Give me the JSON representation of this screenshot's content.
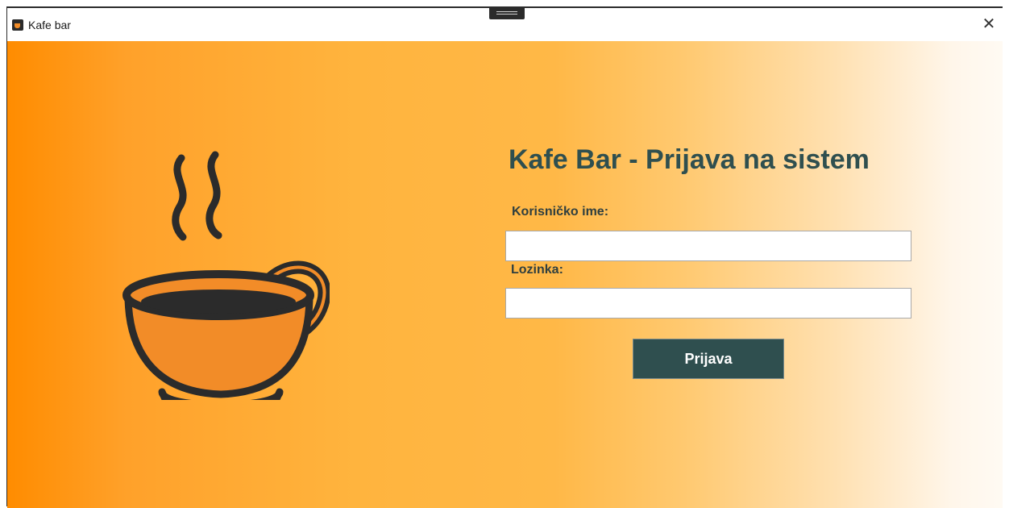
{
  "window": {
    "title": "Kafe bar",
    "app_icon": "coffee-cup-icon",
    "close_glyph": "✕"
  },
  "login": {
    "heading": "Kafe Bar - Prijava na sistem",
    "username_label": "Korisničko ime:",
    "username_value": "",
    "password_label": "Lozinka:",
    "password_value": "",
    "submit_label": "Prijava"
  },
  "illustration": {
    "icon": "coffee-cup-icon"
  },
  "colors": {
    "gradient_start": "#ff8c00",
    "gradient_end": "#fffaf3",
    "heading": "#2f4f4f",
    "button_bg": "#2f4f4f",
    "button_text": "#ffffff",
    "cup_fill": "#f28c28",
    "cup_outline": "#2b2b2b"
  }
}
